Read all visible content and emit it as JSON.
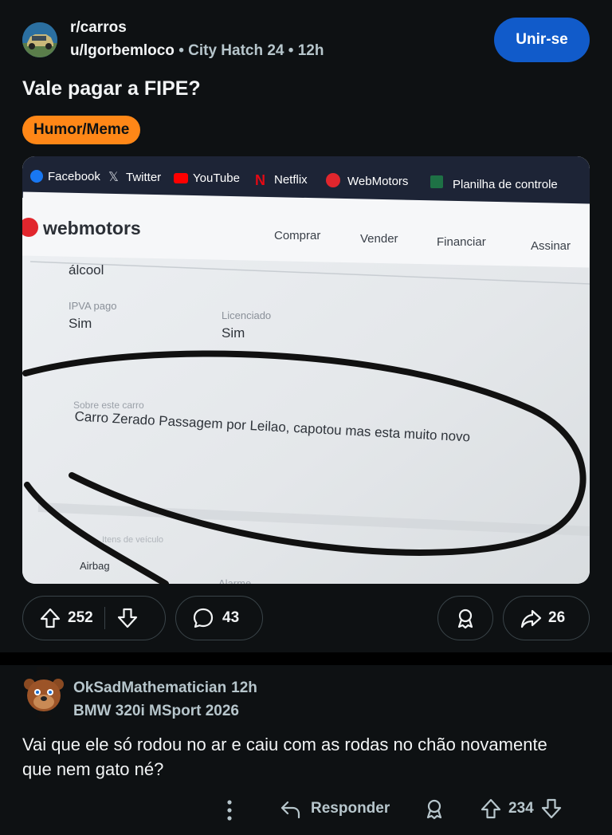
{
  "post": {
    "subreddit": "r/carros",
    "author": "u/lgorbemloco",
    "user_flair": "City Hatch 24",
    "separator": "•",
    "time": "12h",
    "join_label": "Unir-se",
    "title": "Vale pagar a FIPE?",
    "flair": "Humor/Meme",
    "flair_color": "#ff8717",
    "upvotes": "252",
    "comments": "43",
    "shares": "26"
  },
  "screenshot": {
    "bookmarks": [
      "Facebook",
      "Twitter",
      "YouTube",
      "Netflix",
      "WebMotors",
      "Planilha de controle"
    ],
    "logo": "webmotors",
    "nav": [
      "Comprar",
      "Vender",
      "Financiar",
      "Assinar"
    ],
    "fuel_partial": "álcool",
    "ipva_label": "IPVA pago",
    "ipva_value": "Sim",
    "licenciado_label": "Licenciado",
    "licenciado_value": "Sim",
    "about_label": "Sobre este carro",
    "about_text": "Carro Zerado Passagem por Leilao, capotou mas esta muito novo",
    "partial_section": "Itens de veículo",
    "airbag": "Airbag",
    "partial_item": "Alarme"
  },
  "comment": {
    "username": "OkSadMathematician",
    "time": "12h",
    "user_flair": "BMW 320i MSport 2026",
    "body": "Vai que ele só rodou no ar e caiu com as rodas no chão novamente que nem gato né?",
    "reply_label": "Responder",
    "votes": "234"
  },
  "colors": {
    "background": "#0e1113",
    "accent_join": "#115bca",
    "muted_text": "#b7c6cc"
  }
}
